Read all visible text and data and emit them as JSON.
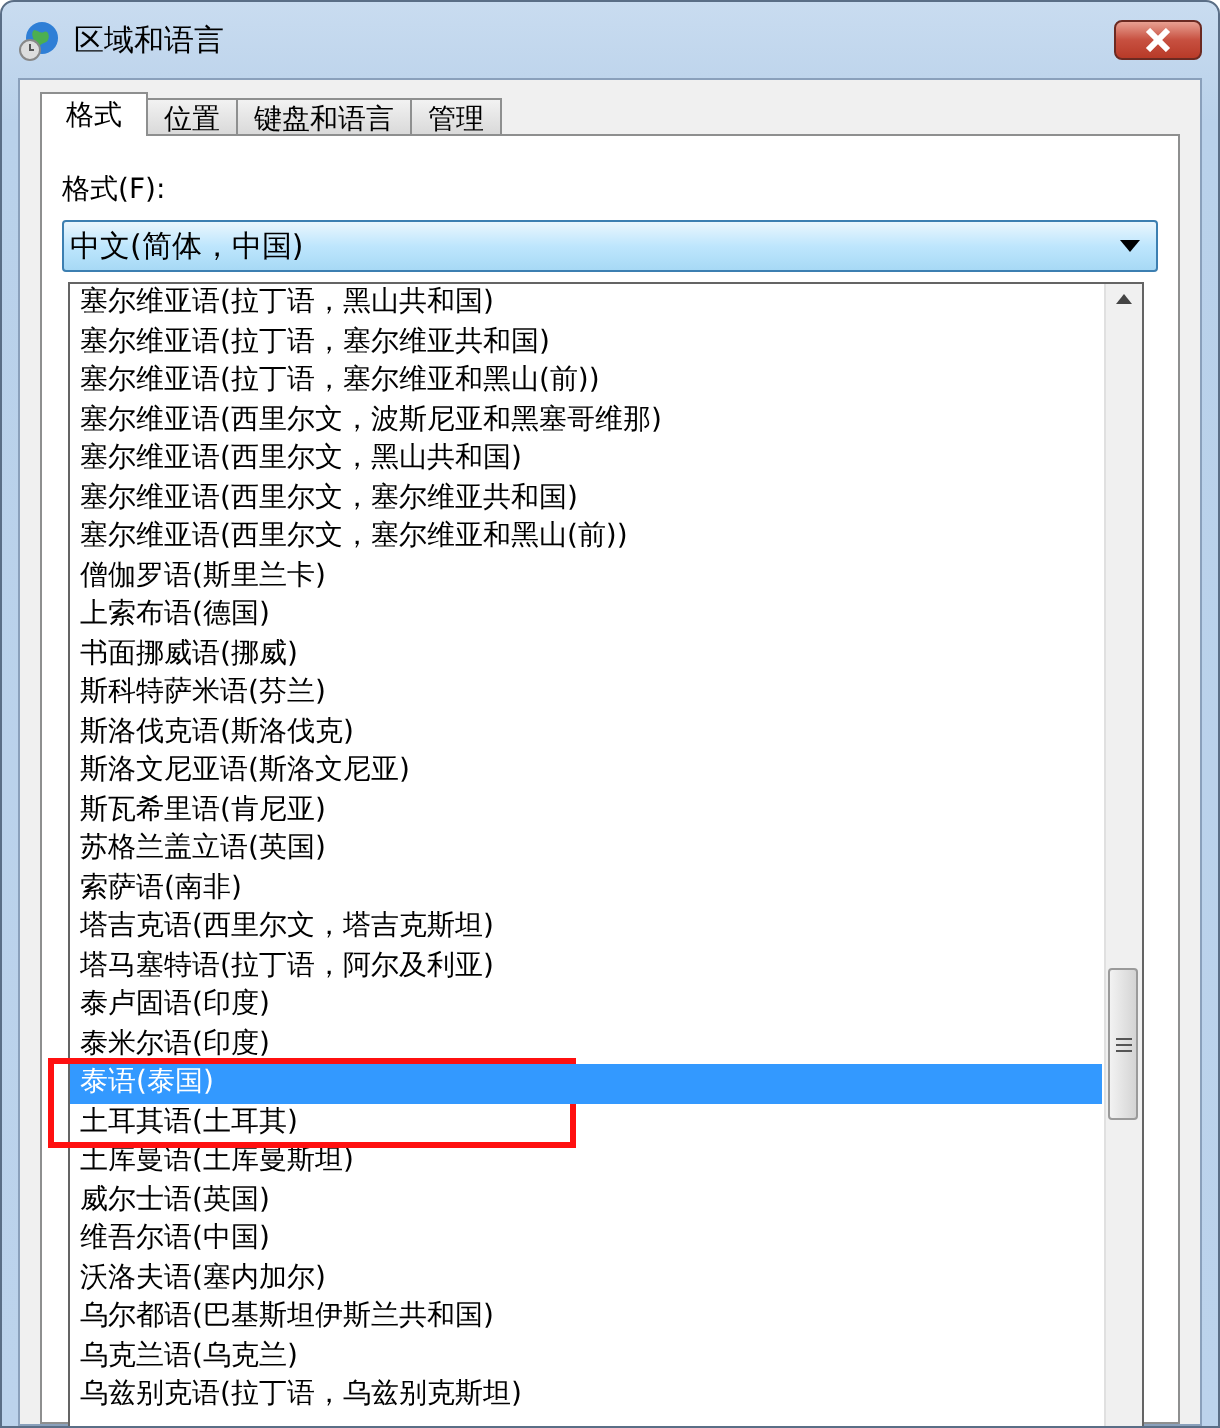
{
  "window": {
    "title": "区域和语言"
  },
  "tabs": [
    {
      "label": "格式",
      "selected": true
    },
    {
      "label": "位置",
      "selected": false
    },
    {
      "label": "键盘和语言",
      "selected": false
    },
    {
      "label": "管理",
      "selected": false
    }
  ],
  "format": {
    "label": "格式(F):",
    "value": "中文(简体，中国)"
  },
  "dropdown_items": [
    {
      "label": "塞尔维亚语(拉丁语，黑山共和国)",
      "selected": false,
      "annotated": false
    },
    {
      "label": "塞尔维亚语(拉丁语，塞尔维亚共和国)",
      "selected": false,
      "annotated": false
    },
    {
      "label": "塞尔维亚语(拉丁语，塞尔维亚和黑山(前))",
      "selected": false,
      "annotated": false
    },
    {
      "label": "塞尔维亚语(西里尔文，波斯尼亚和黑塞哥维那)",
      "selected": false,
      "annotated": false
    },
    {
      "label": "塞尔维亚语(西里尔文，黑山共和国)",
      "selected": false,
      "annotated": false
    },
    {
      "label": "塞尔维亚语(西里尔文，塞尔维亚共和国)",
      "selected": false,
      "annotated": false
    },
    {
      "label": "塞尔维亚语(西里尔文，塞尔维亚和黑山(前))",
      "selected": false,
      "annotated": false
    },
    {
      "label": "僧伽罗语(斯里兰卡)",
      "selected": false,
      "annotated": false
    },
    {
      "label": "上索布语(德国)",
      "selected": false,
      "annotated": false
    },
    {
      "label": "书面挪威语(挪威)",
      "selected": false,
      "annotated": false
    },
    {
      "label": "斯科特萨米语(芬兰)",
      "selected": false,
      "annotated": false
    },
    {
      "label": "斯洛伐克语(斯洛伐克)",
      "selected": false,
      "annotated": false
    },
    {
      "label": "斯洛文尼亚语(斯洛文尼亚)",
      "selected": false,
      "annotated": false
    },
    {
      "label": "斯瓦希里语(肯尼亚)",
      "selected": false,
      "annotated": false
    },
    {
      "label": "苏格兰盖立语(英国)",
      "selected": false,
      "annotated": false
    },
    {
      "label": "索萨语(南非)",
      "selected": false,
      "annotated": false
    },
    {
      "label": "塔吉克语(西里尔文，塔吉克斯坦)",
      "selected": false,
      "annotated": false
    },
    {
      "label": "塔马塞特语(拉丁语，阿尔及利亚)",
      "selected": false,
      "annotated": false
    },
    {
      "label": "泰卢固语(印度)",
      "selected": false,
      "annotated": false
    },
    {
      "label": "泰米尔语(印度)",
      "selected": false,
      "annotated": false
    },
    {
      "label": "泰语(泰国)",
      "selected": true,
      "annotated": true
    },
    {
      "label": "土耳其语(土耳其)",
      "selected": false,
      "annotated": true
    },
    {
      "label": "土库曼语(土库曼斯坦)",
      "selected": false,
      "annotated": false
    },
    {
      "label": "威尔士语(英国)",
      "selected": false,
      "annotated": false
    },
    {
      "label": "维吾尔语(中国)",
      "selected": false,
      "annotated": false
    },
    {
      "label": "沃洛夫语(塞内加尔)",
      "selected": false,
      "annotated": false
    },
    {
      "label": "乌尔都语(巴基斯坦伊斯兰共和国)",
      "selected": false,
      "annotated": false
    },
    {
      "label": "乌克兰语(乌克兰)",
      "selected": false,
      "annotated": false
    },
    {
      "label": "乌兹别克语(拉丁语，乌兹别克斯坦)",
      "selected": false,
      "annotated": false
    }
  ]
}
